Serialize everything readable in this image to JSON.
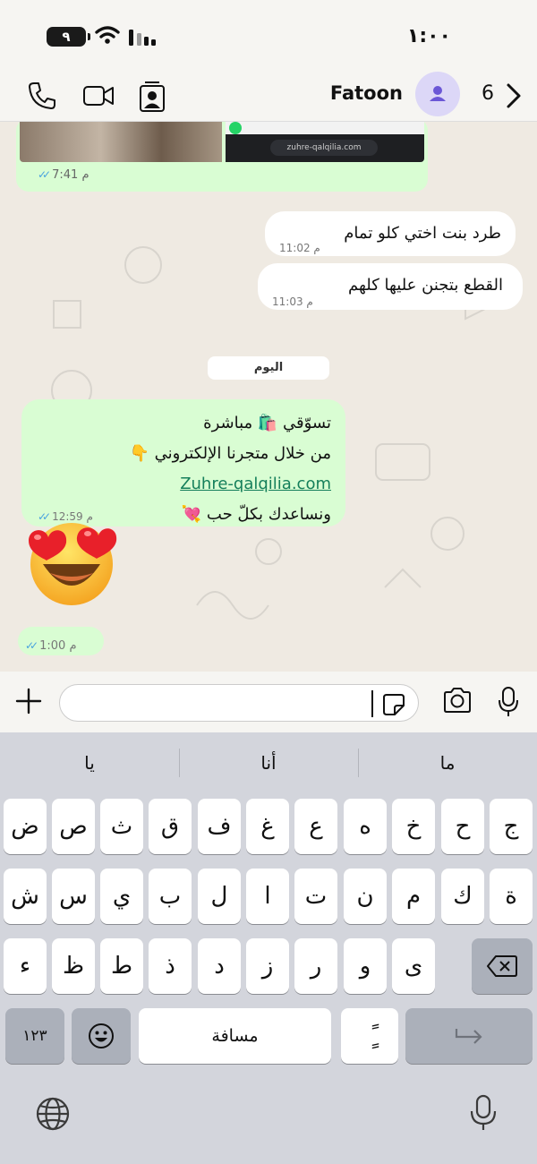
{
  "status_bar": {
    "time": "١:٠٠",
    "battery": "٩"
  },
  "header": {
    "contact_name": "Fatoon",
    "unread_count": "6"
  },
  "messages": {
    "image_message": {
      "time": "7:41 م",
      "preview_url": "zuhre-qalqilia.com"
    },
    "m1": {
      "text": "طرد بنت اختي كلو تمام",
      "time": "11:02 م"
    },
    "m2": {
      "text": "القطع بتجنن عليها كلهم",
      "time": "11:03 م"
    },
    "date_chip": "اليوم",
    "m3": {
      "line1": "تسوّقي 🛍️ مباشرة",
      "line2": "من خلال متجرنا الإلكتروني 👇",
      "link": "Zuhre-qalqilia.com",
      "line4": "ونساعدك بكلّ حب 💘",
      "time": "12:59 م"
    },
    "emoji": "heart-eyes-emoji",
    "m4": {
      "time": "1:00 م"
    }
  },
  "composer": {
    "placeholder": ""
  },
  "keyboard": {
    "suggestions": [
      "ما",
      "أنا",
      "يا"
    ],
    "row1": [
      "ج",
      "ح",
      "خ",
      "ه",
      "ع",
      "غ",
      "ف",
      "ق",
      "ث",
      "ص",
      "ض"
    ],
    "row2": [
      "ة",
      "ك",
      "م",
      "ن",
      "ت",
      "ا",
      "ل",
      "ب",
      "ي",
      "س",
      "ش"
    ],
    "row3": [
      "ى",
      "و",
      "ر",
      "ز",
      "د",
      "ذ",
      "ط",
      "ظ",
      "ء"
    ],
    "numbers_key": "١٢٣",
    "space_key": "مسافة",
    "tanween_key": "ًٍ"
  },
  "colors": {
    "outgoing_bubble": "#d9fdd3",
    "incoming_bubble": "#ffffff",
    "chat_background": "#efeae2",
    "link": "#157f5b",
    "read_ticks": "#4aa3df",
    "avatar_bg": "#dcd7f7",
    "avatar_fg": "#6b57d6"
  }
}
